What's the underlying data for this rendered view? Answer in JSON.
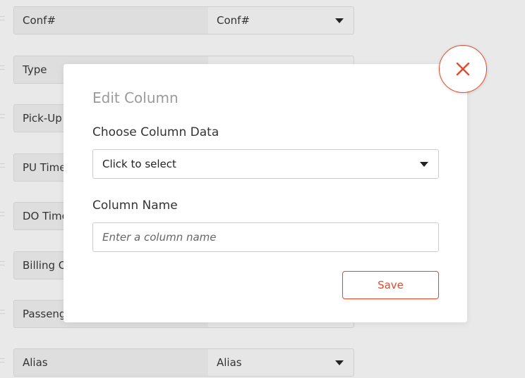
{
  "background": {
    "rows": [
      {
        "label": "Conf#",
        "select": "Conf#"
      },
      {
        "label": "Type",
        "select": ""
      },
      {
        "label": "Pick-Up",
        "select": ""
      },
      {
        "label": "PU Time",
        "select": ""
      },
      {
        "label": "DO Time",
        "select": ""
      },
      {
        "label": "Billing C",
        "select": ""
      },
      {
        "label": "Passeng",
        "select": ""
      },
      {
        "label": "Alias",
        "select": "Alias"
      }
    ]
  },
  "modal": {
    "title": "Edit Column",
    "column_data_label": "Choose Column Data",
    "column_data_select": "Click to select",
    "column_name_label": "Column Name",
    "column_name_placeholder": "Enter a column name",
    "column_name_value": "",
    "save_label": "Save",
    "close_icon": "close-icon"
  },
  "colors": {
    "accent": "#e24a2c",
    "title_gray": "#9a9a9a",
    "overlay_bg": "#e9e9e9"
  }
}
